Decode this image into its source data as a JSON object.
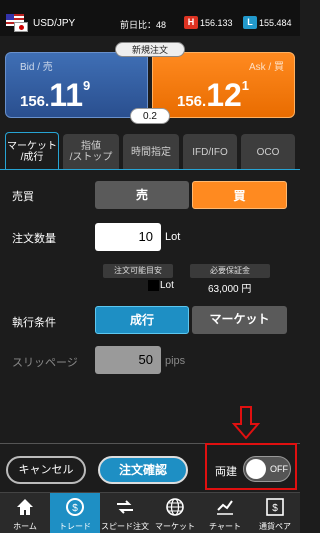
{
  "header": {
    "pair": "USD/JPY",
    "change": "前日比：48",
    "high_badge": "H",
    "high_value": "156.133",
    "low_badge": "L",
    "low_value": "155.484"
  },
  "rates": {
    "new_order_label": "新規注文",
    "bid_label": "Bid / 売",
    "bid_main": "156.",
    "bid_big": "11",
    "bid_sup": "9",
    "ask_label": "Ask / 買",
    "ask_main": "156.",
    "ask_big": "12",
    "ask_sup": "1",
    "spread": "0.2"
  },
  "tabs": [
    {
      "label_line1": "マーケット",
      "label_line2": "/成行",
      "active": true
    },
    {
      "label_line1": "指値",
      "label_line2": "/ストップ",
      "active": false
    },
    {
      "label_line1": "時間指定",
      "label_line2": "",
      "active": false
    },
    {
      "label_line1": "IFD/IFO",
      "label_line2": "",
      "active": false
    },
    {
      "label_line1": "OCO",
      "label_line2": "",
      "active": false
    }
  ],
  "form": {
    "side_label": "売買",
    "sell_label": "売",
    "buy_label": "買",
    "qty_label": "注文数量",
    "qty_value": "10",
    "qty_unit": "Lot",
    "available_label": "注文可能目安",
    "available_unit": "Lot",
    "margin_label": "必要保証金",
    "margin_value": "63,000 円",
    "exec_label": "執行条件",
    "exec_market": "成行",
    "exec_marketplace": "マーケット",
    "slip_label": "スリッページ",
    "slip_value": "50",
    "slip_unit": "pips"
  },
  "actions": {
    "cancel": "キャンセル",
    "confirm": "注文確認",
    "both_label": "両建",
    "toggle_state": "OFF"
  },
  "nav": [
    {
      "label": "ホーム",
      "icon": "home-icon",
      "active": false
    },
    {
      "label": "トレード",
      "icon": "trade-icon",
      "active": true
    },
    {
      "label": "スピード注文",
      "icon": "speed-order-icon",
      "active": false
    },
    {
      "label": "マーケット",
      "icon": "globe-icon",
      "active": false
    },
    {
      "label": "チャート",
      "icon": "chart-icon",
      "active": false
    },
    {
      "label": "通貨ペア",
      "icon": "currency-pair-icon",
      "active": false
    }
  ],
  "colors": {
    "accent": "#1e8fc4",
    "ask": "#ff8a20",
    "bid": "#3f6fb5",
    "highlight": "#e01010"
  }
}
